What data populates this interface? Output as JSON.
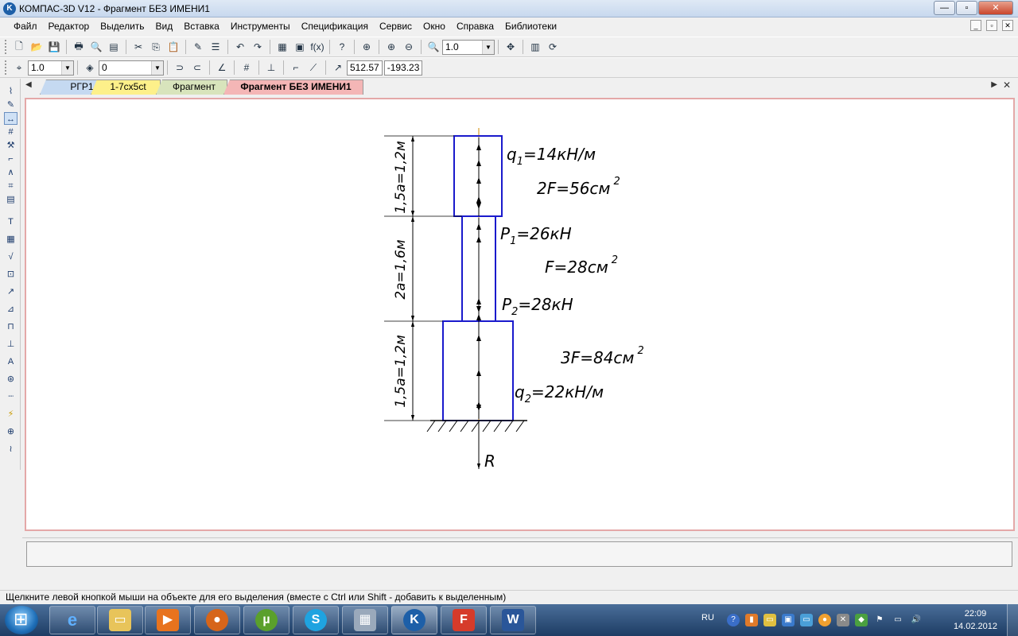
{
  "window": {
    "title": "КОМПАС-3D V12 - Фрагмент БЕЗ ИМЕНИ1",
    "logo": "K",
    "controls": {
      "minimize": "—",
      "maximize": "▫",
      "close": "✕"
    }
  },
  "menu": {
    "items": [
      "Файл",
      "Редактор",
      "Выделить",
      "Вид",
      "Вставка",
      "Инструменты",
      "Спецификация",
      "Сервис",
      "Окно",
      "Справка",
      "Библиотеки"
    ]
  },
  "toolbar1": {
    "zoom_value": "1.0",
    "icons": [
      "new-icon",
      "open-icon",
      "save-icon",
      "print-icon",
      "preview-icon",
      "cut-icon",
      "copy-icon",
      "paste-icon",
      "undo-icon",
      "redo-icon",
      "zoom-icon"
    ]
  },
  "toolbar2": {
    "line_scale": "1.0",
    "layer": "0",
    "coord_x": "512.57",
    "coord_y": "-193.23"
  },
  "tabs": [
    {
      "label": "РГР1",
      "color": "#c5d9f1"
    },
    {
      "label": "1-7сх5ct",
      "color": "#fdf08a"
    },
    {
      "label": "Фрагмент",
      "color": "#d8e4bc"
    },
    {
      "label": "Фрагмент БЕЗ ИМЕНИ1",
      "color": "#f4b6b6"
    }
  ],
  "drawing": {
    "labels": {
      "q1": "q",
      "q1_sub": "1",
      "q1_rest": "=14кН/м",
      "area1": "2F=56см",
      "area1_sup": "2",
      "p1": "P",
      "p1_sub": "1",
      "p1_rest": "=26кН",
      "area2": "F=28см",
      "area2_sup": "2",
      "p2": "P",
      "p2_sub": "2",
      "p2_rest": "=28кН",
      "area3": "3F=84см",
      "area3_sup": "2",
      "q2": "q",
      "q2_sub": "2",
      "q2_rest": "=22кН/м",
      "reaction": "R",
      "dim1": "1,5a=1,2м",
      "dim2": "2a=1,6м",
      "dim3": "1,5a=1,2м"
    },
    "colors": {
      "outline": "#1a1acc",
      "axis": "#d08a00",
      "line": "#000000"
    }
  },
  "status": {
    "text": "Щелкните левой кнопкой мыши на объекте для его выделения (вместе с Ctrl или Shift - добавить к выделенным)"
  },
  "taskbar": {
    "apps": [
      "ie-icon",
      "explorer-icon",
      "media-player-icon",
      "firefox-icon",
      "utorrent-icon",
      "skype-icon",
      "calculator-icon",
      "kompas-icon",
      "foxit-icon",
      "word-icon"
    ],
    "lang": "RU",
    "time": "22:09",
    "date": "14.02.2012"
  }
}
